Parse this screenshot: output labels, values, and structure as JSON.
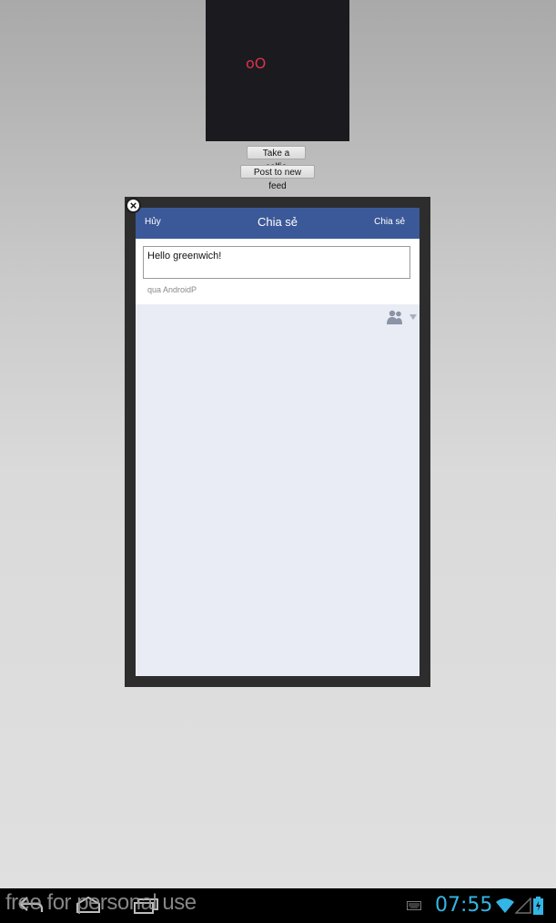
{
  "preview": {
    "text": "oO"
  },
  "buttons": {
    "take_selfie": "Take a selfie",
    "post_feed": "Post to new feed"
  },
  "share_dialog": {
    "cancel": "Hủy",
    "title": "Chia sẻ",
    "share": "Chia sẻ",
    "message": "Hello greenwich!",
    "via": "qua AndroidP",
    "audience_icon": "friends-icon"
  },
  "status_bar": {
    "watermark": "free for personal use",
    "time": "07:55",
    "icons": [
      "back-icon",
      "home-icon",
      "recent-apps-icon",
      "keyboard-icon",
      "wifi-icon",
      "signal-icon",
      "battery-icon"
    ]
  },
  "colors": {
    "facebook_blue": "#3b5998",
    "clock_blue": "#33b5e5"
  }
}
